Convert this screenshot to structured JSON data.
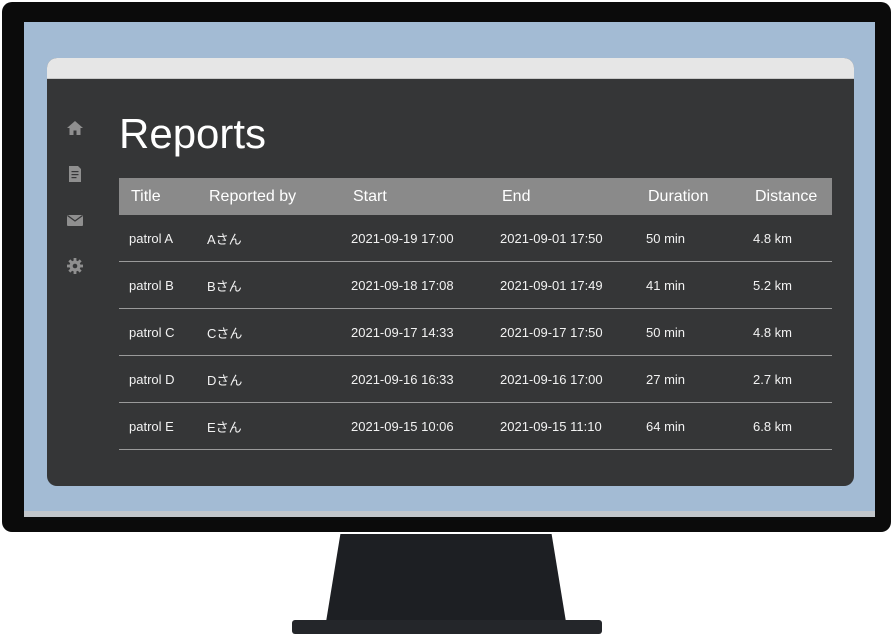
{
  "page": {
    "title": "Reports"
  },
  "sidebar": {
    "items": [
      {
        "icon": "home-icon"
      },
      {
        "icon": "document-icon"
      },
      {
        "icon": "mail-icon"
      },
      {
        "icon": "gear-icon"
      }
    ]
  },
  "table": {
    "headers": [
      "Title",
      "Reported by",
      "Start",
      "End",
      "Duration",
      "Distance"
    ],
    "rows": [
      [
        "patrol A",
        "Aさん",
        "2021-09-19 17:00",
        "2021-09-01 17:50",
        "50 min",
        "4.8 km"
      ],
      [
        "patrol B",
        "Bさん",
        "2021-09-18 17:08",
        "2021-09-01 17:49",
        "41 min",
        "5.2 km"
      ],
      [
        "patrol C",
        "Cさん",
        "2021-09-17 14:33",
        "2021-09-17 17:50",
        "50 min",
        "4.8 km"
      ],
      [
        "patrol D",
        "Dさん",
        "2021-09-16 16:33",
        "2021-09-16 17:00",
        "27 min",
        "2.7 km"
      ],
      [
        "patrol E",
        "Eさん",
        "2021-09-15 10:06",
        "2021-09-15 11:10",
        "64 min",
        "6.8 km"
      ]
    ]
  },
  "colors": {
    "window_bg": "#353637",
    "header_bg": "#8a8a8a",
    "screen_bg": "#a3bbd4",
    "icon": "#8f8f8f"
  }
}
